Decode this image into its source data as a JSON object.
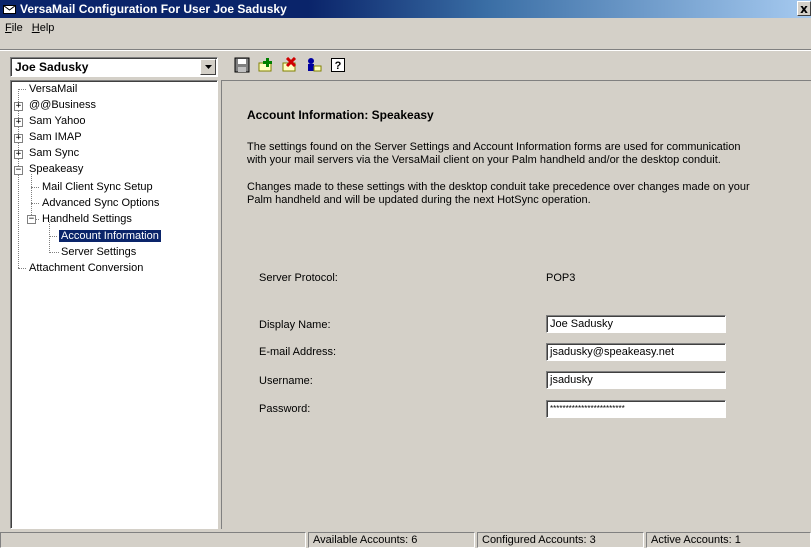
{
  "window": {
    "title": "VersaMail Configuration For User Joe Sadusky",
    "close_label": "x"
  },
  "menu": [
    "File",
    "Help"
  ],
  "user_select": {
    "value": "Joe Sadusky"
  },
  "toolbar": {
    "buttons": [
      {
        "icon": "save-icon"
      },
      {
        "icon": "add-account-icon"
      },
      {
        "icon": "delete-account-icon"
      },
      {
        "icon": "user-settings-icon"
      },
      {
        "icon": "help-icon"
      }
    ]
  },
  "tree": {
    "items": [
      {
        "label": "VersaMail",
        "expander": ""
      },
      {
        "label": "@@Business",
        "expander": "+"
      },
      {
        "label": "Sam Yahoo",
        "expander": "+"
      },
      {
        "label": "Sam IMAP",
        "expander": "+"
      },
      {
        "label": "Sam Sync",
        "expander": "+"
      },
      {
        "label": "Speakeasy",
        "expander": "−"
      },
      {
        "label": "Mail Client Sync Setup",
        "expander": ""
      },
      {
        "label": "Advanced Sync Options",
        "expander": ""
      },
      {
        "label": "Handheld Settings",
        "expander": "−"
      },
      {
        "label": "Account Information",
        "expander": "",
        "selected": true
      },
      {
        "label": "Server Settings",
        "expander": ""
      },
      {
        "label": "Attachment Conversion",
        "expander": ""
      }
    ]
  },
  "panel": {
    "heading": "Account Information: Speakeasy",
    "para1_line1": "The settings found on the Server Settings and Account Information forms are used for communication",
    "para1_line2": "with your mail servers via the VersaMail client on your Palm handheld and/or the desktop conduit.",
    "para2_line1": "Changes made to these settings with the desktop conduit take precedence over changes made on your",
    "para2_line2": "Palm handheld and will be updated during the next HotSync operation.",
    "server_protocol_label": "Server Protocol:",
    "server_protocol_value": "POP3",
    "display_name_label": "Display Name:",
    "display_name_value": "Joe Sadusky",
    "email_label": "E-mail Address:",
    "email_value": "jsadusky@speakeasy.net",
    "username_label": "Username:",
    "username_value": "jsadusky",
    "password_label": "Password:",
    "password_value": "************************"
  },
  "status": {
    "available": "Available Accounts: 6",
    "configured": "Configured Accounts: 3",
    "active": "Active Accounts: 1"
  }
}
